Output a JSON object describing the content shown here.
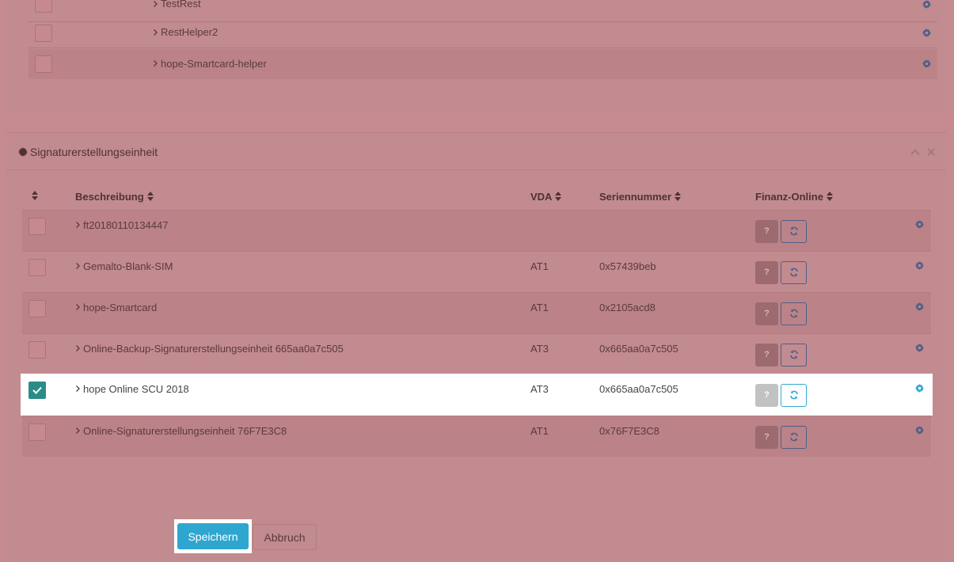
{
  "top_tree": {
    "items": [
      {
        "label": "TestRest"
      },
      {
        "label": "RestHelper2"
      },
      {
        "label": "hope-Smartcard-helper"
      }
    ]
  },
  "scu_panel": {
    "title": "Signaturerstellungseinheit",
    "columns": {
      "beschreibung": "Beschreibung",
      "vda": "VDA",
      "seriennummer": "Seriennummer",
      "finanz_online": "Finanz-Online"
    },
    "question_label": "?",
    "rows": [
      {
        "description": "ft20180110134447",
        "vda": "",
        "serial": "",
        "checked": false
      },
      {
        "description": "Gemalto-Blank-SIM",
        "vda": "AT1",
        "serial": "0x57439beb",
        "checked": false
      },
      {
        "description": "hope-Smartcard",
        "vda": "AT1",
        "serial": "0x2105acd8",
        "checked": false
      },
      {
        "description": "Online-Backup-Signaturerstellungseinheit 665aa0a7c505",
        "vda": "AT3",
        "serial": "0x665aa0a7c505",
        "checked": false
      },
      {
        "description": "hope Online SCU 2018",
        "vda": "AT3",
        "serial": "0x665aa0a7c505",
        "checked": true
      },
      {
        "description": "Online-Signaturerstellungseinheit 76F7E3C8",
        "vda": "AT1",
        "serial": "0x76F7E3C8",
        "checked": false
      }
    ]
  },
  "footer": {
    "save_label": "Speichern",
    "cancel_label": "Abbruch"
  },
  "colors": {
    "overlay": "#c68b90",
    "accent": "#2fa6cf",
    "check": "#2a8c86"
  }
}
